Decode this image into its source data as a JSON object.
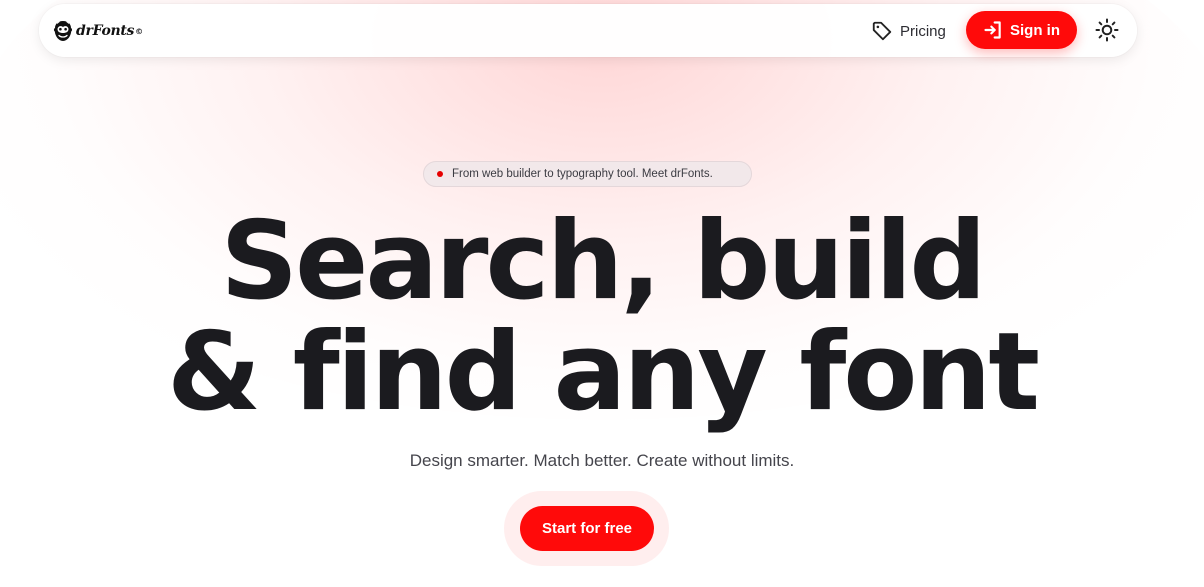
{
  "brand": {
    "name": "drFonts",
    "mark": "©",
    "logo_icon": "monkey-head-icon"
  },
  "nav": {
    "pricing_label": "Pricing",
    "pricing_icon": "tag-icon",
    "signin_label": "Sign in",
    "signin_icon": "sign-in-icon",
    "theme_icon": "sun-icon"
  },
  "hero": {
    "announcement": "From web builder to typography tool. Meet drFonts.",
    "headline_line1": "Search, build",
    "headline_line2": "& find any font",
    "subtitle": "Design smarter. Match better. Create without limits.",
    "cta_label": "Start for free"
  },
  "colors": {
    "accent": "#ff0a0a",
    "text": "#1b1b1f",
    "muted": "#45454c"
  }
}
